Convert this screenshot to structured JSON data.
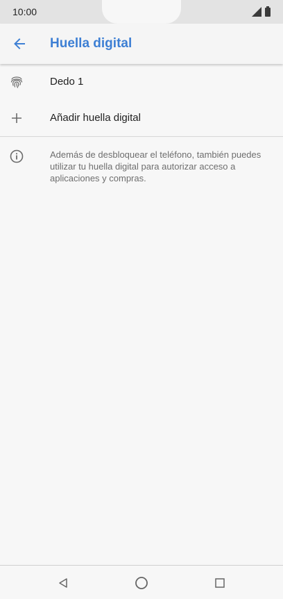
{
  "status_bar": {
    "time": "10:00"
  },
  "app_bar": {
    "title": "Huella digital",
    "title_color": "#3d7fd4"
  },
  "list": {
    "items": [
      {
        "icon": "fingerprint-icon",
        "label": "Dedo 1"
      },
      {
        "icon": "plus-icon",
        "label": "Añadir huella digital"
      }
    ]
  },
  "info": {
    "icon": "info-icon",
    "text": "Además de desbloquear el teléfono, también puedes utilizar tu huella digital para autorizar acceso a aplicaciones y compras."
  },
  "nav_bar": {
    "buttons": [
      "back-icon",
      "home-icon",
      "recents-icon"
    ]
  }
}
